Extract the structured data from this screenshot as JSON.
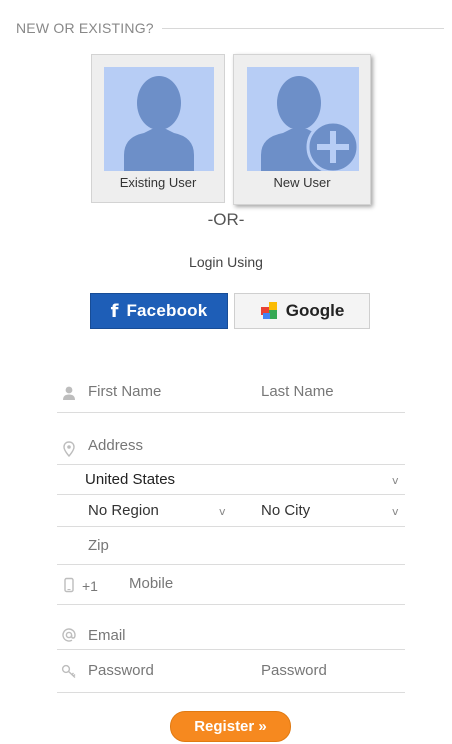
{
  "header": {
    "title": "NEW OR EXISTING?"
  },
  "user_choice": {
    "existing_label": "Existing User",
    "new_label": "New User"
  },
  "separator": "-OR-",
  "social": {
    "heading": "Login Using",
    "facebook_icon": "f",
    "facebook_label": "Facebook",
    "google_label": "Google"
  },
  "form": {
    "first_name_placeholder": "First Name",
    "last_name_placeholder": "Last Name",
    "address_placeholder": "Address",
    "country_value": "United States",
    "region_value": "No Region",
    "city_value": "No City",
    "zip_placeholder": "Zip",
    "phone_code": "+1",
    "mobile_placeholder": "Mobile",
    "email_placeholder": "Email",
    "password_placeholder": "Password",
    "confirm_password_placeholder": "Password",
    "dropdown_chevron": "v"
  },
  "register": {
    "label": "Register »"
  },
  "colors": {
    "facebook": "#1e5eb7",
    "register": "#f6891f",
    "avatar_bg": "#b7cdf5",
    "avatar_fg": "#6d8fc8"
  }
}
